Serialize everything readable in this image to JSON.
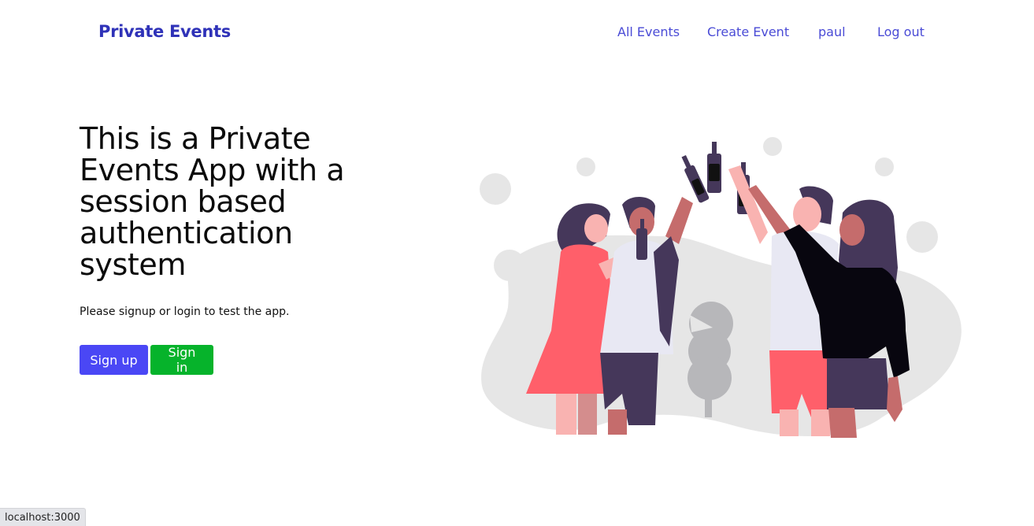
{
  "navbar": {
    "brand": "Private Events",
    "links": [
      {
        "label": "All Events"
      },
      {
        "label": "Create Event"
      },
      {
        "label": "paul"
      },
      {
        "label": "Log out"
      }
    ]
  },
  "hero": {
    "title": "This is a Private Events App with a session based authentication system",
    "subtitle": "Please signup or login to test the app.",
    "signup_label": "Sign up",
    "signin_label": "Sign in"
  },
  "status_bar": {
    "url": "localhost:3000"
  },
  "colors": {
    "brand": "#2f32b8",
    "nav_link": "#4a4bd6",
    "signup_button": "#4a47f5",
    "signin_button": "#06b32b"
  },
  "illustration": {
    "icon": "friends-toasting-illustration"
  }
}
